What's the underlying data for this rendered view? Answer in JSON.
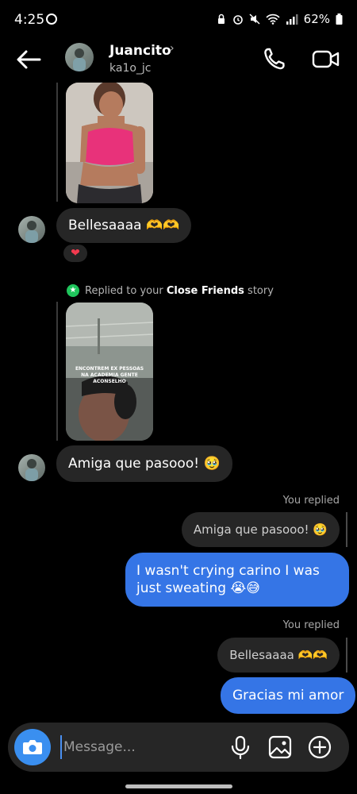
{
  "status_bar": {
    "time": "4:25",
    "battery": "62%"
  },
  "header": {
    "name": "Juancito",
    "username": "ka1o_jc"
  },
  "messages": {
    "bellesa_text": "Bellesaaaa 🫶🫶",
    "reaction": "❤",
    "replied_prefix": "Replied to your",
    "replied_bold": "Close Friends",
    "replied_suffix": "story",
    "story_overlay": "ENCONTREM EX PESSOAS NA ACADEMIA GENTE ACONSELHO",
    "amiga_text": "Amiga que pasooo! 🥹",
    "you_replied_1": "You replied",
    "quoted_1": "Amiga que pasooo! 🥹",
    "out_1": "I wasn't crying carino I was just sweating 😭😅",
    "you_replied_2": "You replied",
    "quoted_2": "Bellesaaaa 🫶🫶",
    "out_2": "Gracias mi amor"
  },
  "composer": {
    "placeholder": "Message..."
  },
  "colors": {
    "accent": "#3575e6",
    "camera": "#3a8ff0",
    "bubble_in": "#262626",
    "story_green": "#1fc55c"
  },
  "icons": [
    "back-arrow-icon",
    "phone-icon",
    "video-camera-icon",
    "camera-icon",
    "microphone-icon",
    "gallery-icon",
    "plus-icon",
    "heart-icon"
  ]
}
